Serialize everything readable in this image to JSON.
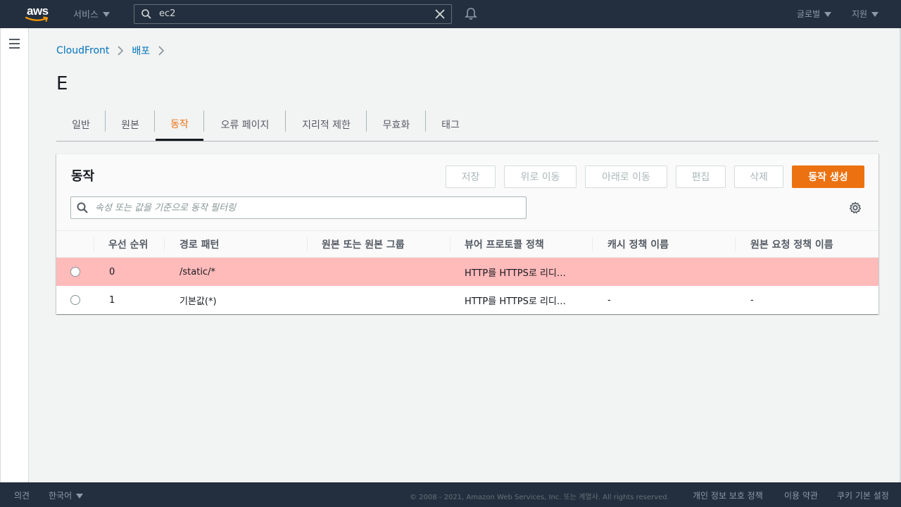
{
  "topnav": {
    "logo_text": "aws",
    "services_label": "서비스",
    "search_value": "ec2",
    "global_label": "글로벌",
    "support_label": "지원"
  },
  "breadcrumb": {
    "items": [
      "CloudFront",
      "배포"
    ]
  },
  "page": {
    "title": "E"
  },
  "tabs": [
    {
      "label": "일반",
      "active": false
    },
    {
      "label": "원본",
      "active": false
    },
    {
      "label": "동작",
      "active": true
    },
    {
      "label": "오류 페이지",
      "active": false
    },
    {
      "label": "지리적 제한",
      "active": false
    },
    {
      "label": "무효화",
      "active": false
    },
    {
      "label": "태그",
      "active": false
    }
  ],
  "behaviors": {
    "title": "동작",
    "buttons": {
      "save": "저장",
      "move_up": "위로 이동",
      "move_down": "아래로 이동",
      "edit": "편집",
      "delete": "삭제",
      "create": "동작 생성"
    },
    "filter_placeholder": "속성 또는 값을 기준으로 동작 필터링",
    "columns": [
      "우선 순위",
      "경로 패턴",
      "원본 또는 원본 그룹",
      "뷰어 프로토콜 정책",
      "캐시 정책 이름",
      "원본 요청 정책 이름"
    ],
    "rows": [
      {
        "priority": "0",
        "path": "/static/*",
        "origin": "",
        "viewer_policy": "HTTP를 HTTPS로 리디…",
        "cache_policy": "",
        "origin_request_policy": "",
        "selected": true
      },
      {
        "priority": "1",
        "path": "기본값(*)",
        "origin": "",
        "viewer_policy": "HTTP를 HTTPS로 리디…",
        "cache_policy": "-",
        "origin_request_policy": "-",
        "selected": false
      }
    ]
  },
  "footer": {
    "feedback": "의견",
    "language": "한국어",
    "copyright": "© 2008 - 2021, Amazon Web Services, Inc. 또는 계열사. All rights reserved.",
    "privacy": "개인 정보 보호 정책",
    "terms": "이용 약관",
    "cookies": "쿠키 기본 설정"
  },
  "colors": {
    "nav_bg": "#232f3e",
    "accent": "#ec7211",
    "link": "#0073bb",
    "selected_row": "#ffbaba"
  }
}
